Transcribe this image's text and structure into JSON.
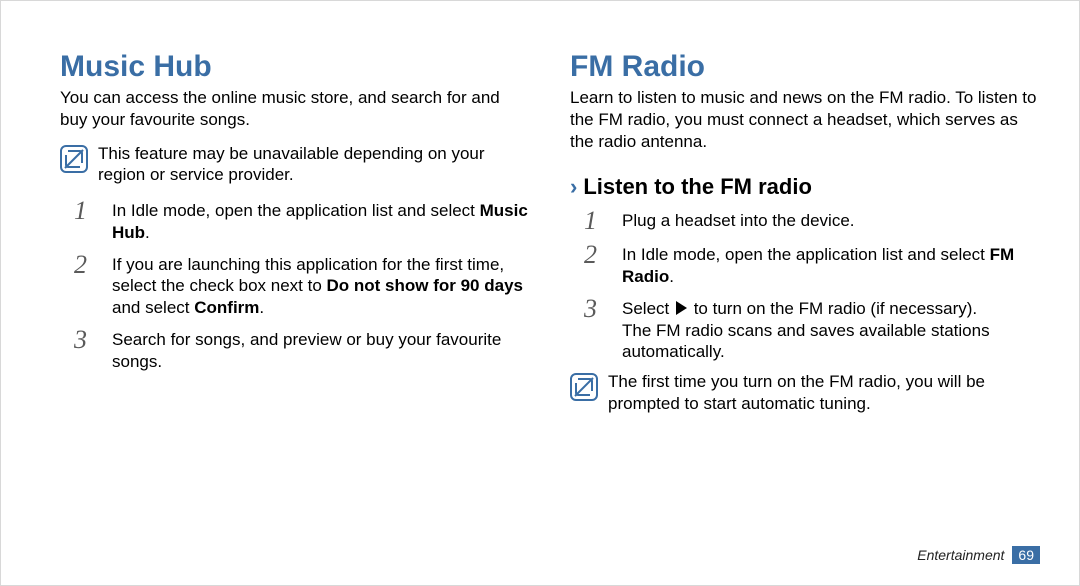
{
  "colors": {
    "accent": "#3a6ea5"
  },
  "left": {
    "title": "Music Hub",
    "intro": "You can access the online music store, and search for and buy your favourite songs.",
    "note": "This feature may be unavailable depending on your region or service provider.",
    "steps": [
      {
        "num": "1",
        "text_pre": "In Idle mode, open the application list and select ",
        "bold": "Music Hub",
        "text_post": "."
      },
      {
        "num": "2",
        "text_pre": "If you are launching this application for the first time, select the check box next to ",
        "bold": "Do not show for 90 days",
        "text_mid": " and select ",
        "bold2": "Confirm",
        "text_post": "."
      },
      {
        "num": "3",
        "text_pre": "Search for songs, and preview or buy your favourite songs.",
        "bold": "",
        "text_post": ""
      }
    ]
  },
  "right": {
    "title": "FM Radio",
    "intro": "Learn to listen to music and news on the FM radio. To listen to the FM radio, you must connect a headset, which serves as the radio antenna.",
    "subheading": "Listen to the FM radio",
    "steps": [
      {
        "num": "1",
        "text_pre": "Plug a headset into the device.",
        "bold": "",
        "text_post": ""
      },
      {
        "num": "2",
        "text_pre": "In Idle mode, open the application list and select ",
        "bold": "FM Radio",
        "text_post": "."
      },
      {
        "num": "3",
        "line1_pre": "Select ",
        "line1_post": " to turn on the FM radio (if necessary).",
        "line2": "The FM radio scans and saves available stations automatically."
      }
    ],
    "note": "The first time you turn on the FM radio, you will be prompted to start automatic tuning."
  },
  "footer": {
    "category": "Entertainment",
    "page": "69"
  }
}
